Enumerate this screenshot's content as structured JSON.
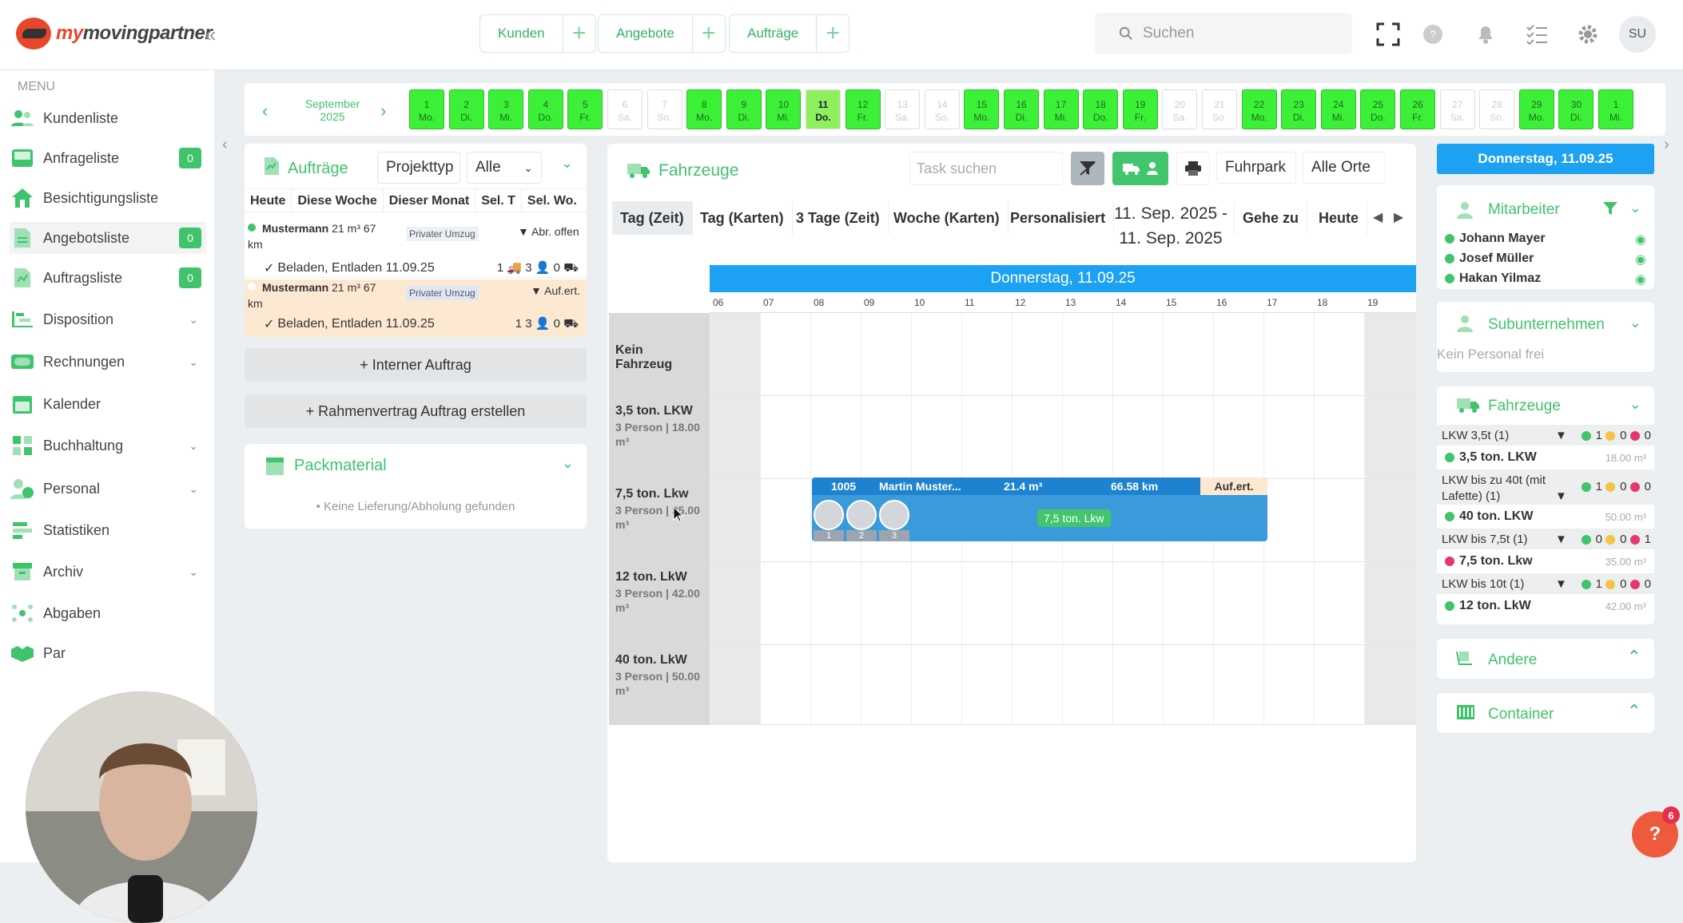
{
  "header": {
    "logo_prefix": "my",
    "logo_name": "movingpartner",
    "buttons": [
      {
        "label": "Kunden"
      },
      {
        "label": "Angebote"
      },
      {
        "label": "Aufträge"
      }
    ],
    "search_placeholder": "Suchen",
    "avatar_initials": "SU"
  },
  "sidebar": {
    "menu_title": "MENU",
    "items": [
      {
        "label": "Kundenliste",
        "icon": "users-icon"
      },
      {
        "label": "Anfrageliste",
        "icon": "inbox-icon",
        "badge": "0"
      },
      {
        "label": "Besichtigungsliste",
        "icon": "house-icon"
      },
      {
        "label": "Angebotsliste",
        "icon": "document-icon",
        "badge": "0"
      },
      {
        "label": "Auftragsliste",
        "icon": "document-icon",
        "badge": "0"
      },
      {
        "label": "Disposition",
        "icon": "timeline-icon"
      },
      {
        "label": "Rechnungen",
        "icon": "money-icon"
      },
      {
        "label": "Kalender",
        "icon": "calendar-icon"
      },
      {
        "label": "Buchhaltung",
        "icon": "grid-icon"
      },
      {
        "label": "Personal",
        "icon": "person-clock-icon"
      },
      {
        "label": "Statistiken",
        "icon": "bars-icon"
      },
      {
        "label": "Archiv",
        "icon": "archive-icon"
      },
      {
        "label": "Abgaben",
        "icon": "network-icon"
      },
      {
        "label": "Par",
        "icon": "handshake-icon"
      }
    ]
  },
  "datestrip": {
    "month": "September",
    "year": "2025",
    "days": [
      {
        "n": "1",
        "d": "Mo.",
        "s": "on"
      },
      {
        "n": "2",
        "d": "Di.",
        "s": "on"
      },
      {
        "n": "3",
        "d": "Mi.",
        "s": "on"
      },
      {
        "n": "4",
        "d": "Do.",
        "s": "on"
      },
      {
        "n": "5",
        "d": "Fr.",
        "s": "on"
      },
      {
        "n": "6",
        "d": "Sa.",
        "s": "we"
      },
      {
        "n": "7",
        "d": "So.",
        "s": "we"
      },
      {
        "n": "8",
        "d": "Mo.",
        "s": "on"
      },
      {
        "n": "9",
        "d": "Di.",
        "s": "on"
      },
      {
        "n": "10",
        "d": "Mi.",
        "s": "on"
      },
      {
        "n": "11",
        "d": "Do.",
        "s": "today"
      },
      {
        "n": "12",
        "d": "Fr.",
        "s": "on"
      },
      {
        "n": "13",
        "d": "Sa.",
        "s": "we"
      },
      {
        "n": "14",
        "d": "So.",
        "s": "we"
      },
      {
        "n": "15",
        "d": "Mo.",
        "s": "on"
      },
      {
        "n": "16",
        "d": "Di.",
        "s": "on"
      },
      {
        "n": "17",
        "d": "Mi.",
        "s": "on"
      },
      {
        "n": "18",
        "d": "Do.",
        "s": "on"
      },
      {
        "n": "19",
        "d": "Fr.",
        "s": "on"
      },
      {
        "n": "20",
        "d": "Sa.",
        "s": "we"
      },
      {
        "n": "21",
        "d": "So.",
        "s": "we"
      },
      {
        "n": "22",
        "d": "Mo.",
        "s": "on"
      },
      {
        "n": "23",
        "d": "Di.",
        "s": "on"
      },
      {
        "n": "24",
        "d": "Mi.",
        "s": "on"
      },
      {
        "n": "25",
        "d": "Do.",
        "s": "on"
      },
      {
        "n": "26",
        "d": "Fr.",
        "s": "on"
      },
      {
        "n": "27",
        "d": "Sa.",
        "s": "we"
      },
      {
        "n": "28",
        "d": "So.",
        "s": "we"
      },
      {
        "n": "29",
        "d": "Mo.",
        "s": "on"
      },
      {
        "n": "30",
        "d": "Di.",
        "s": "on"
      },
      {
        "n": "1",
        "d": "Mi.",
        "s": "on"
      }
    ]
  },
  "auftraege": {
    "title": "Aufträge",
    "projekttyp": "Projekttyp",
    "filter": "Alle",
    "tabs": [
      "Heute",
      "Diese Woche",
      "Dieser Monat",
      "Sel. T",
      "Sel. Wo."
    ],
    "orders": [
      {
        "name": "Mustermann",
        "volume": "21 m³",
        "distance": "67",
        "unit": "km",
        "type": "Privater Umzug",
        "status": "Abr. offen",
        "task": "Beladen, Entladen 11.09.25",
        "trucks": "1",
        "persons": "3",
        "other": "0"
      },
      {
        "name": "Mustermann",
        "volume": "21 m³",
        "distance": "67",
        "unit": "km",
        "type": "Privater Umzug",
        "status": "Auf.ert.",
        "task": "Beladen, Entladen 11.09.25",
        "trucks": "1",
        "persons": "3",
        "other": "0"
      }
    ],
    "btn_internal": "+ Interner Auftrag",
    "btn_rahmen": "+ Rahmenvertrag Auftrag erstellen"
  },
  "packmaterial": {
    "title": "Packmaterial",
    "empty": "• Keine Lieferung/Abholung gefunden"
  },
  "fahrzeuge": {
    "title": "Fahrzeuge",
    "task_placeholder": "Task suchen",
    "fuhrpark": "Fuhrpark",
    "alle_orte": "Alle Orte",
    "views": [
      "Tag (Zeit)",
      "Tag (Karten)",
      "3 Tage (Zeit)",
      "Woche (Karten)",
      "Personalisiert"
    ],
    "range_line1": "11. Sep. 2025 -",
    "range_line2": "11. Sep. 2025",
    "gehe_zu": "Gehe zu",
    "heute": "Heute",
    "day_header": "Donnerstag, 11.09.25",
    "hours": [
      "06",
      "07",
      "08",
      "09",
      "10",
      "11",
      "12",
      "13",
      "14",
      "15",
      "16",
      "17",
      "18",
      "19"
    ],
    "rows": [
      {
        "name": "Kein Fahrzeug",
        "sub": ""
      },
      {
        "name": "3,5 ton. LKW",
        "sub": "3 Person | 18.00 m³"
      },
      {
        "name": "7,5 ton. Lkw",
        "sub": "3 Person | 35.00 m³"
      },
      {
        "name": "12 ton. LkW",
        "sub": "3 Person | 42.00 m³"
      },
      {
        "name": "40 ton. LkW",
        "sub": "3 Person | 50.00 m³"
      }
    ],
    "event": {
      "id": "1005",
      "customer": "Martin Muster...",
      "volume": "21.4 m³",
      "distance": "66.58 km",
      "status": "Auf.ert.",
      "vehicle": "7,5 ton. Lkw",
      "slots": [
        "1",
        "2",
        "3"
      ]
    }
  },
  "right": {
    "date": "Donnerstag, 11.09.25",
    "mitarbeiter_title": "Mitarbeiter",
    "mitarbeiter": [
      "Johann Mayer",
      "Josef Müller",
      "Hakan Yilmaz"
    ],
    "sub_title": "Subunternehmen",
    "sub_empty": "Kein Personal frei",
    "fz_title": "Fahrzeuge",
    "fz_groups": [
      {
        "head": "LKW 3,5t (1)",
        "counts": [
          "1",
          "0",
          "0"
        ],
        "item": "3,5 ton. LKW",
        "cap": "18.00 m³",
        "dot": "g"
      },
      {
        "head": "LKW bis zu 40t (mit Lafette) (1)",
        "counts": [
          "1",
          "0",
          "0"
        ],
        "item": "40 ton. LKW",
        "cap": "50.00 m³",
        "dot": "g"
      },
      {
        "head": "LKW bis 7,5t (1)",
        "counts": [
          "0",
          "0",
          "1"
        ],
        "item": "7,5 ton. Lkw",
        "cap": "35.00 m³",
        "dot": "r"
      },
      {
        "head": "LKW bis 10t (1)",
        "counts": [
          "1",
          "0",
          "0"
        ],
        "item": "12 ton. LkW",
        "cap": "42.00 m³",
        "dot": "g"
      }
    ],
    "andere_title": "Andere",
    "container_title": "Container"
  },
  "help": {
    "label": "?",
    "count": "6"
  },
  "colors": {
    "accent": "#3fc36b",
    "blue": "#1da1f2",
    "brand": "#e8462b"
  }
}
